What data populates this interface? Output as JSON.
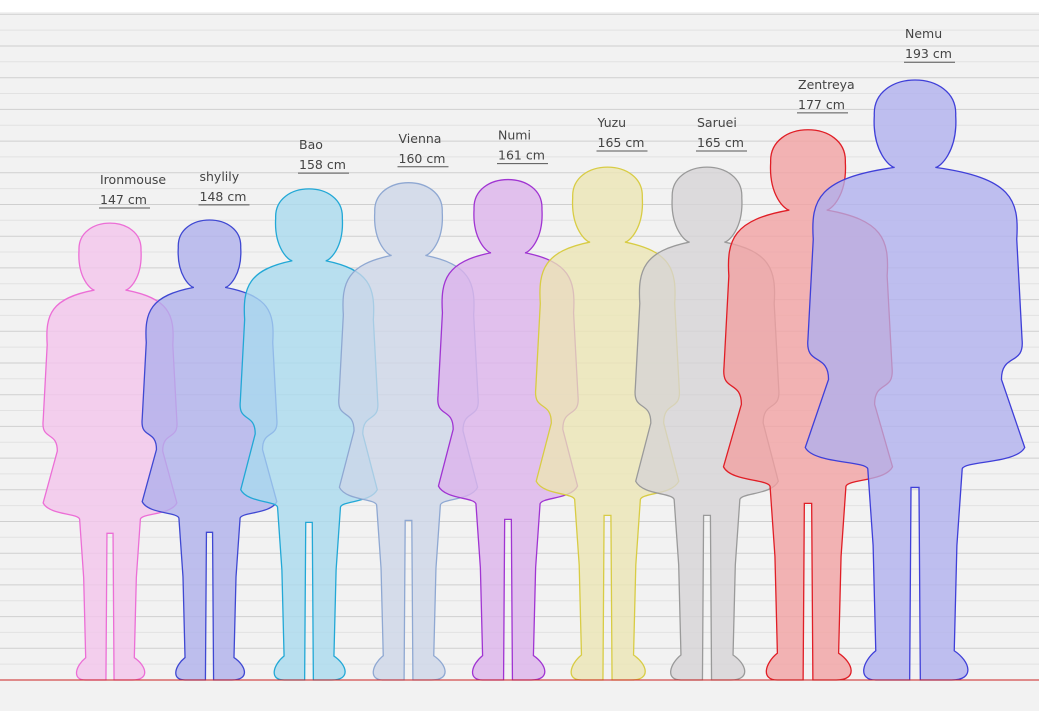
{
  "chart_data": {
    "type": "height comparison",
    "unit": "cm",
    "characters": [
      {
        "name": "Ironmouse",
        "height": 147,
        "height_label": "147 cm",
        "color": "#ec6ed6",
        "fill": "#f4c4ec"
      },
      {
        "name": "shylily",
        "height": 148,
        "height_label": "148 cm",
        "color": "#3f48d2",
        "fill": "#aeb0ec"
      },
      {
        "name": "Bao",
        "height": 158,
        "height_label": "158 cm",
        "color": "#22a8d6",
        "fill": "#a8daee"
      },
      {
        "name": "Vienna",
        "height": 160,
        "height_label": "160 cm",
        "color": "#8fa8d2",
        "fill": "#cdd6e8"
      },
      {
        "name": "Numi",
        "height": 161,
        "height_label": "161 cm",
        "color": "#a034d2",
        "fill": "#dcb2ec"
      },
      {
        "name": "Yuzu",
        "height": 165,
        "height_label": "165 cm",
        "color": "#d8cc44",
        "fill": "#ece6b4"
      },
      {
        "name": "Saruei",
        "height": 165,
        "height_label": "165 cm",
        "color": "#9a9a9a",
        "fill": "#d6d4d6"
      },
      {
        "name": "Zentreya",
        "height": 177,
        "height_label": "177 cm",
        "color": "#e01e26",
        "fill": "#f2a0a2"
      },
      {
        "name": "Nemu",
        "height": 193,
        "height_label": "193 cm",
        "color": "#3f3fd8",
        "fill": "#b0b0ee"
      }
    ],
    "grid": true,
    "baseline_color": "#cc2222",
    "grid_color": "#cfcfcf",
    "background_band_color": "#f2f2f2"
  }
}
